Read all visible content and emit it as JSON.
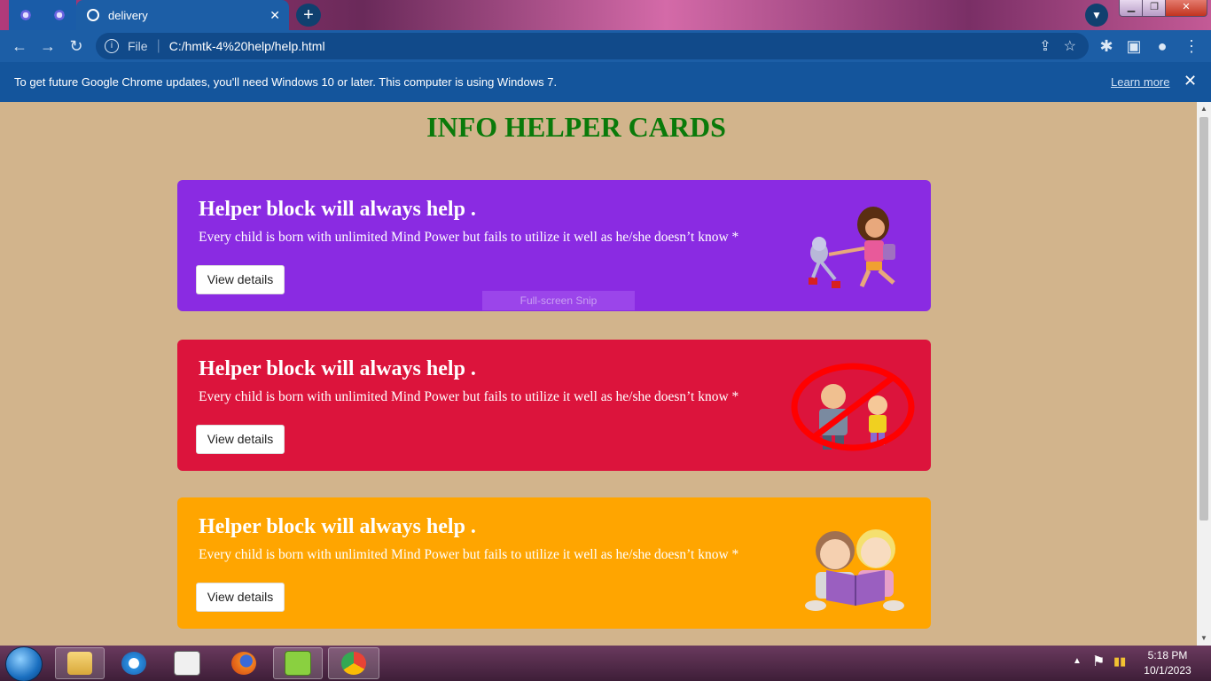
{
  "browser": {
    "tab_title": "delivery",
    "tab_close": "✕",
    "new_tab": "+",
    "file_label": "File",
    "url": "C:/hmtk-4%20help/help.html"
  },
  "infobar": {
    "message": "To get future Google Chrome updates, you'll need Windows 10 or later. This computer is using Windows 7.",
    "learn_more": "Learn more",
    "close": "✕"
  },
  "page": {
    "title": "INFO HELPER CARDS",
    "cards": [
      {
        "heading": "Helper block will always help .",
        "text": "Every child is born with unlimited Mind Power but fails to utilize it well as he/she doesn’t know *",
        "button": "View details",
        "color": "#8a2be2"
      },
      {
        "heading": "Helper block will always help .",
        "text": "Every child is born with unlimited Mind Power but fails to utilize it well as he/she doesn’t know *",
        "button": "View details",
        "color": "#dc143c"
      },
      {
        "heading": "Helper block will always help .",
        "text": "Every child is born with unlimited Mind Power but fails to utilize it well as he/she doesn’t know *",
        "button": "View details",
        "color": "#ffa500"
      }
    ],
    "snip_label": "Full-screen Snip"
  },
  "taskbar": {
    "apps": [
      "explorer-icon",
      "internet-explorer-icon",
      "document-icon",
      "firefox-icon",
      "notepad-plus-icon",
      "chrome-icon"
    ],
    "time": "5:18 PM",
    "date": "10/1/2023"
  }
}
